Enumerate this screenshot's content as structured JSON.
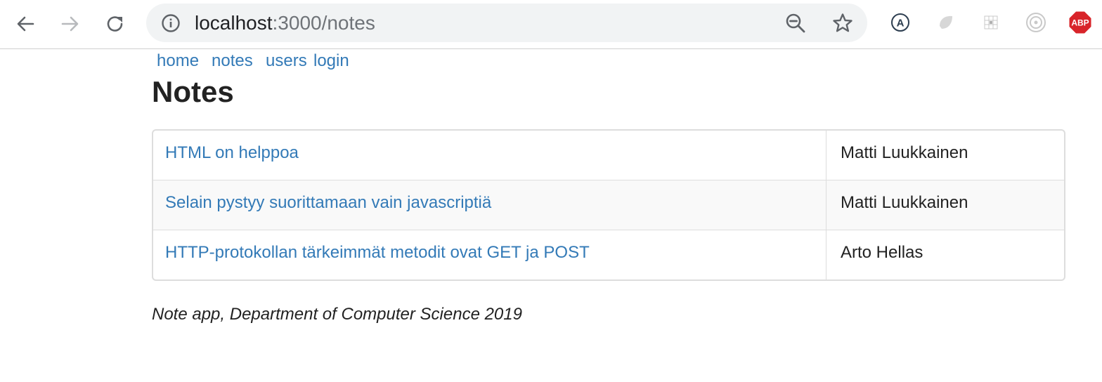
{
  "browser": {
    "url_host": "localhost",
    "url_rest": ":3000/notes",
    "icons": {
      "back": "back-arrow-icon",
      "forward": "forward-arrow-icon",
      "reload": "reload-icon",
      "info": "info-icon",
      "zoom": "zoom-out-icon",
      "bookmark": "star-icon"
    },
    "extensions": [
      "translate-extension-icon",
      "leaf-extension-icon",
      "grid-extension-icon",
      "target-extension-icon",
      "adblock-plus-icon"
    ],
    "abp_label": "ABP"
  },
  "nav": {
    "home": "home",
    "notes": "notes",
    "users": "users",
    "login": "login"
  },
  "page": {
    "title": "Notes",
    "footer": "Note app, Department of Computer Science 2019"
  },
  "notes": [
    {
      "title": "HTML on helppoa",
      "author": "Matti Luukkainen"
    },
    {
      "title": "Selain pystyy suorittamaan vain javascriptiä",
      "author": "Matti Luukkainen"
    },
    {
      "title": "HTTP-protokollan tärkeimmät metodit ovat GET ja POST",
      "author": "Arto Hellas"
    }
  ],
  "colors": {
    "link": "#337ab7",
    "text": "#222222",
    "table_border": "#dddddd",
    "stripe": "#f9f9f9",
    "abp_red": "#d8242a"
  }
}
